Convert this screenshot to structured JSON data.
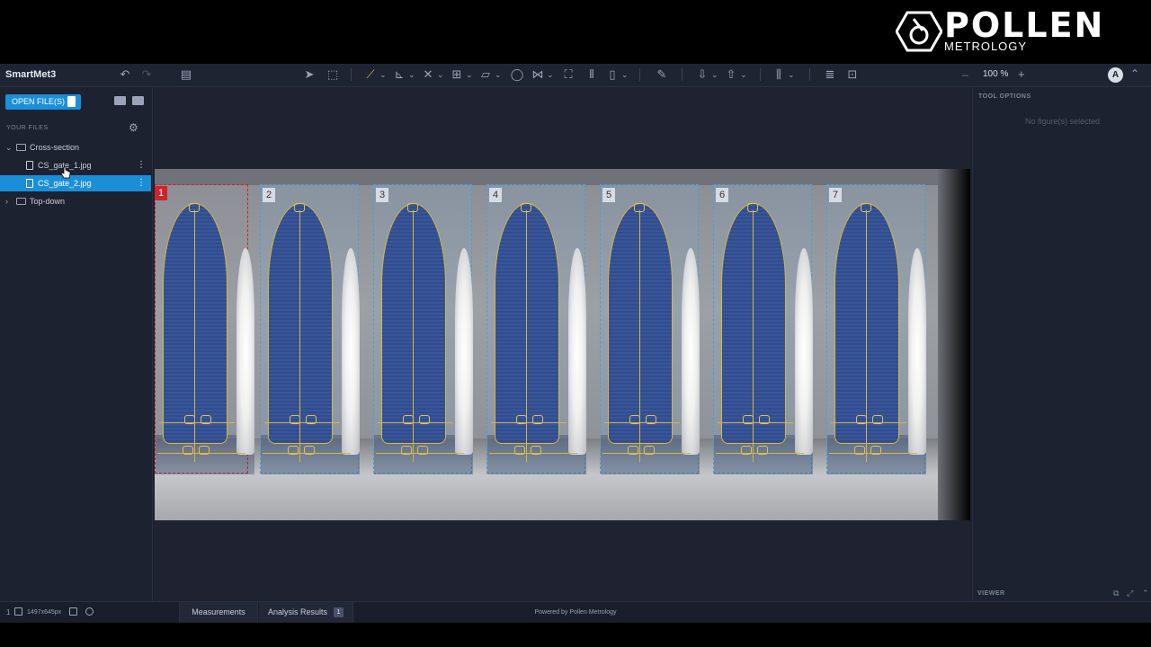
{
  "brand": {
    "wordmark": "POLLEN",
    "subtitle": "METROLOGY"
  },
  "app": {
    "title": "SmartMet3",
    "zoom": "100 %",
    "zoom_minus": "–",
    "zoom_plus": "+",
    "avatar_initial": "A",
    "more": "⌃"
  },
  "sidebar": {
    "open_files_label": "OPEN FILE(S)",
    "section_label": "YOUR FILES",
    "tree": [
      {
        "label": "Cross-section",
        "type": "folder",
        "expanded": true
      },
      {
        "label": "CS_gate_1.jpg",
        "type": "file",
        "selected": false
      },
      {
        "label": "CS_gate_2.jpg",
        "type": "file",
        "selected": true
      },
      {
        "label": "Top-down",
        "type": "folder",
        "expanded": false
      }
    ]
  },
  "canvas": {
    "gates": [
      "1",
      "2",
      "3",
      "4",
      "5",
      "6",
      "7"
    ],
    "active_gate": "1"
  },
  "right_panel": {
    "tool_options_label": "TOOL OPTIONS",
    "empty_message": "No figure(s) selected",
    "viewer_label": "VIEWER"
  },
  "statusbar": {
    "page": "1",
    "resolution": "1497x645px",
    "tabs": {
      "measurements": "Measurements",
      "analysis_results": "Analysis Results",
      "analysis_count": "1"
    },
    "powered_by": "Powered by Pollen Metrology"
  },
  "colors": {
    "accent": "#1a8fd8",
    "active_gate_border": "#d2222a",
    "annotation": "#d8b640",
    "gate_fill": "#3b5aa0"
  }
}
